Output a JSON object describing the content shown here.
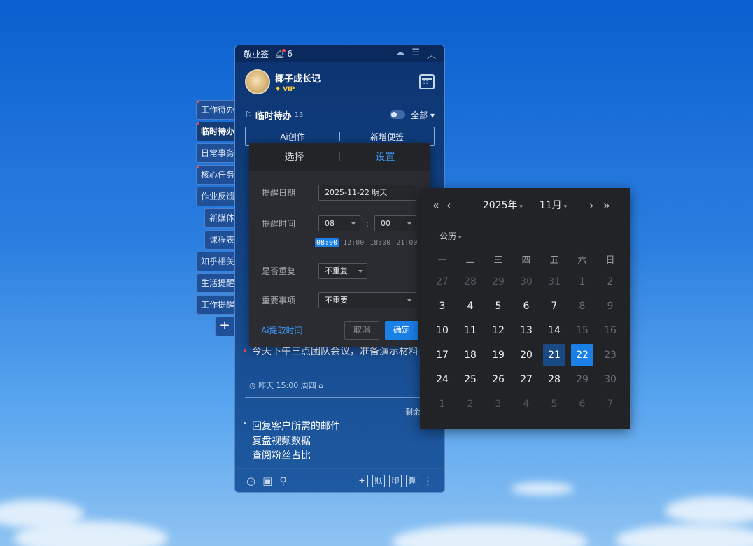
{
  "side_tabs": [
    {
      "label": "工作待办",
      "dot": true,
      "active": false
    },
    {
      "label": "临时待办",
      "dot": true,
      "active": true
    },
    {
      "label": "日常事务",
      "dot": false,
      "active": false
    },
    {
      "label": "核心任务",
      "dot": true,
      "active": false
    },
    {
      "label": "作业反馈",
      "dot": false,
      "active": false
    },
    {
      "label": "新媒体",
      "dot": false,
      "active": false
    },
    {
      "label": "课程表",
      "dot": false,
      "active": false
    },
    {
      "label": "知乎相关",
      "dot": false,
      "active": false
    },
    {
      "label": "生活提醒",
      "dot": false,
      "active": false
    },
    {
      "label": "工作提醒",
      "dot": false,
      "active": false
    }
  ],
  "add_tab": "+",
  "app": {
    "title": "敬业签",
    "notif_count": "6"
  },
  "user": {
    "name": "椰子成长记",
    "vip": "VIP"
  },
  "section": {
    "title": "临时待办",
    "count": "13",
    "filter": "全部"
  },
  "actions": {
    "ai": "Ai创作",
    "new": "新增便签"
  },
  "notes": [
    {
      "text": "今天下午三点团队会议，准备演示材料",
      "meta": "昨天 15:00 周四"
    },
    {
      "lines": [
        "回复客户所需的邮件",
        "复盘视频数据",
        "查阅粉丝占比"
      ]
    }
  ],
  "remain_label": "剩余",
  "footer": {
    "boxes": [
      "+",
      "账",
      "印",
      "算"
    ]
  },
  "popup": {
    "tabs": [
      "选择",
      "设置"
    ],
    "date_label": "提醒日期",
    "date_value": "2025-11-22 明天",
    "time_label": "提醒时间",
    "hour": "08",
    "minute": "00",
    "colon": ":",
    "quick_times": [
      "08:00",
      "12:00",
      "18:00",
      "21:00"
    ],
    "repeat_label": "是否重复",
    "repeat_value": "不重复",
    "important_label": "重要事项",
    "important_value": "不重要",
    "ai_link": "Ai提取时间",
    "cancel": "取消",
    "ok": "确定"
  },
  "calendar": {
    "year": "2025年",
    "month": "11月",
    "calendar_type": "公历",
    "weekdays": [
      "一",
      "二",
      "三",
      "四",
      "五",
      "六",
      "日"
    ],
    "days": [
      [
        "27",
        "28",
        "29",
        "30",
        "31",
        "1",
        "2"
      ],
      [
        "3",
        "4",
        "5",
        "6",
        "7",
        "8",
        "9"
      ],
      [
        "10",
        "11",
        "12",
        "13",
        "14",
        "15",
        "16"
      ],
      [
        "17",
        "18",
        "19",
        "20",
        "21",
        "22",
        "23"
      ],
      [
        "24",
        "25",
        "26",
        "27",
        "28",
        "29",
        "30"
      ],
      [
        "1",
        "2",
        "3",
        "4",
        "5",
        "6",
        "7"
      ]
    ],
    "today": "21",
    "selected": "22"
  },
  "colors": {
    "accent": "#1b7fe8",
    "panel": "#0c3370",
    "popup_bg": "#2b2c31"
  }
}
